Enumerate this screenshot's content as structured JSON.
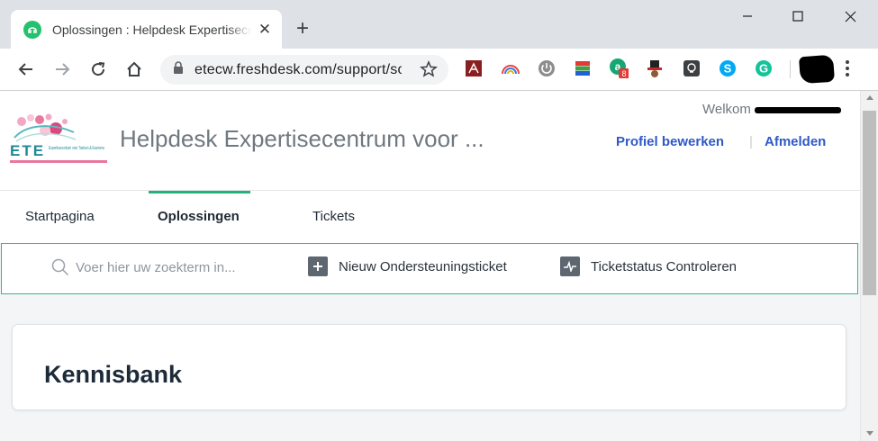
{
  "browser": {
    "tab": {
      "title": "Oplossingen : Helpdesk Expertisecentrum voor Toetsen & Examens"
    },
    "address_bar": {
      "url": "etecw.freshdesk.com/support/solutions"
    },
    "extensions": [
      {
        "icon": "pdf-icon"
      },
      {
        "icon": "rainbow-icon"
      },
      {
        "icon": "power-icon"
      },
      {
        "icon": "layers-icon"
      },
      {
        "icon": "grammarly-badge-icon",
        "badge": "8"
      },
      {
        "icon": "hat-icon"
      },
      {
        "icon": "bulb-icon"
      },
      {
        "icon": "skype-icon"
      },
      {
        "icon": "grammarly-icon"
      }
    ]
  },
  "header": {
    "logo_text": "ETE",
    "logo_subtext": "Expertisecentrum voor Toetsen & Examens",
    "site_title": "Helpdesk Expertisecentrum voor ...",
    "welcome_label": "Welkom",
    "profile_link": "Profiel bewerken",
    "separator": "|",
    "logout_link": "Afmelden"
  },
  "nav": {
    "tabs": [
      {
        "label": "Startpagina",
        "active": false
      },
      {
        "label": "Oplossingen",
        "active": true
      },
      {
        "label": "Tickets",
        "active": false
      }
    ]
  },
  "search": {
    "placeholder": "Voer hier uw zoekterm in...",
    "actions": [
      {
        "label": "Nieuw Ondersteuningsticket",
        "icon": "plus-icon"
      },
      {
        "label": "Ticketstatus Controleren",
        "icon": "pulse-icon"
      }
    ]
  },
  "main": {
    "section_title": "Kennisbank"
  },
  "colors": {
    "accent_green": "#25b27a",
    "link_blue": "#2f59c6"
  }
}
